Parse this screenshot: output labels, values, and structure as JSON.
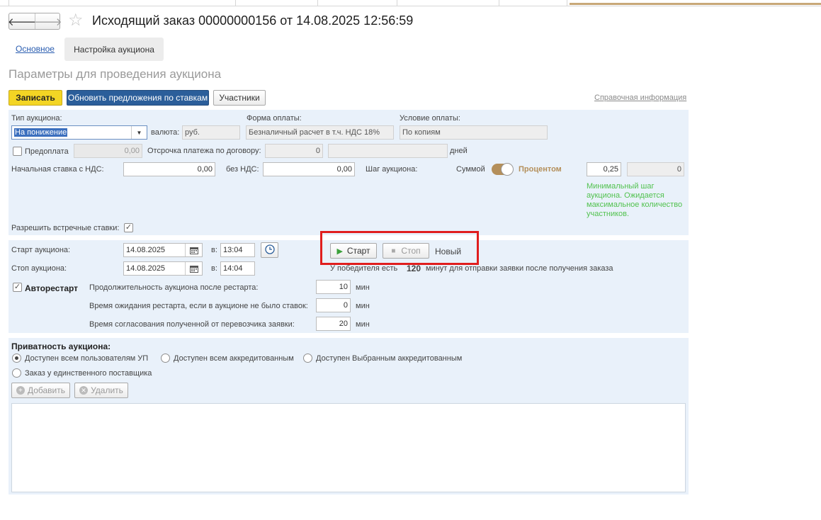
{
  "header": {
    "title": "Исходящий заказ 00000000156 от 14.08.2025 12:56:59",
    "back_icon": "arrow-left-icon",
    "forward_icon": "arrow-right-icon",
    "favorite_icon": "star-icon"
  },
  "tabs": [
    {
      "label": "Основное"
    },
    {
      "label": "Настройка аукциона"
    }
  ],
  "section_title": "Параметры для проведения аукциона",
  "toolbar": {
    "save_label": "Записать",
    "update_offers_label": "Обновить предложения по ставкам",
    "participants_label": "Участники",
    "reference_link": "Справочная информация"
  },
  "params": {
    "auction_type_label": "Тип аукциона:",
    "auction_type_value": "На понижение",
    "currency_label": "валюта:",
    "currency_value": "руб.",
    "payment_form_label": "Форма оплаты:",
    "payment_form_value": "Безналичный расчет в т.ч. НДС 18%",
    "payment_condition_label": "Условие оплаты:",
    "payment_condition_value": "По копиям",
    "prepayment_label": "Предоплата",
    "prepayment_value": "0,00",
    "deferral_label": "Отсрочка платежа по договору:",
    "deferral_value": "0",
    "days_label": "дней",
    "start_bid_vat_label": "Начальная ставка с НДС:",
    "start_bid_vat_value": "0,00",
    "no_vat_label": "без НДС:",
    "no_vat_value": "0,00",
    "step_label": "Шаг аукциона:",
    "by_sum_label": "Суммой",
    "by_percent_label": "Процентом",
    "step_value": "0,25",
    "step_sum_value": "0",
    "hint": "Минимальный шаг аукциона. Ожидается максимальное количество участников.",
    "counter_bids_label": "Разрешить встречные ставки:",
    "counter_bids_checked": true
  },
  "schedule": {
    "start_label": "Старт аукциона:",
    "start_date": "14.08.2025",
    "at_label": "в:",
    "start_time": "13:04",
    "stop_label": "Стоп аукциона:",
    "stop_date": "14.08.2025",
    "stop_time": "14:04",
    "start_button": "Старт",
    "stop_button": "Стоп",
    "status": "Новый",
    "winner_text_1": "У победителя есть",
    "winner_minutes": "120",
    "winner_text_2": "минут для отправки заявки после получения заказа",
    "autorestart_label": "Авторестарт",
    "autorestart_checked": true,
    "restart_duration_label": "Продолжительность аукциона после рестарта:",
    "restart_duration_value": "10",
    "restart_wait_label": "Время ожидания рестарта, если в аукционе не было ставок:",
    "restart_wait_value": "0",
    "approval_time_label": "Время согласования полученной от перевозчика заявки:",
    "approval_time_value": "20",
    "min_label": "мин"
  },
  "privacy": {
    "title": "Приватность аукциона:",
    "options": [
      {
        "label": "Доступен всем пользователям УП",
        "selected": true
      },
      {
        "label": "Доступен всем аккредитованным",
        "selected": false
      },
      {
        "label": "Доступен Выбранным аккредитованным",
        "selected": false
      },
      {
        "label": "Заказ у единственного поставщика",
        "selected": false
      }
    ],
    "add_button": "Добавить",
    "delete_button": "Удалить"
  },
  "colors": {
    "accent_yellow": "#f3d524",
    "accent_blue": "#2b5e9a",
    "panel_bg": "#e9f1fa",
    "hint_green": "#52c24f",
    "highlight_red": "#e01e1e",
    "toggle_brown": "#b48f5a"
  }
}
